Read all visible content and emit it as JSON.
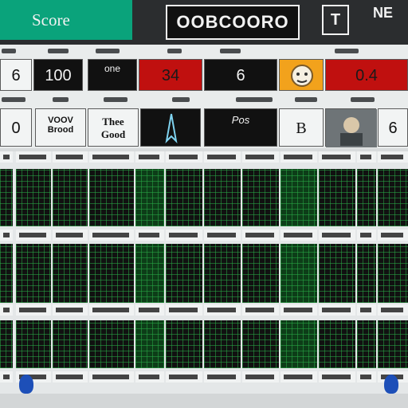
{
  "header": {
    "score_label": "Score",
    "title": "OOBCOORO",
    "tool_icon": "T",
    "corner_label": "NE"
  },
  "row1": [
    {
      "value": "6"
    },
    {
      "value": "100"
    },
    {
      "value": "one"
    },
    {
      "value": "34"
    },
    {
      "value": "6"
    },
    {
      "value": ""
    },
    {
      "value": "0.4"
    }
  ],
  "row2": [
    {
      "value": "0"
    },
    {
      "line1": "VOOV",
      "line2": "Brood"
    },
    {
      "line1": "Thee",
      "line2": "Good"
    },
    {
      "value": ""
    },
    {
      "value": "Pos"
    },
    {
      "value": "B"
    },
    {
      "value": ""
    },
    {
      "value": "6"
    }
  ],
  "icons": {
    "avatar": "lion-avatar-icon",
    "rocket": "rocket-icon",
    "drop_left": "drop-icon",
    "drop_right": "drop-icon"
  },
  "colors": {
    "accent": "#0aa37b",
    "alert": "#c0100f",
    "warning": "#f2a21c",
    "grid_green": "#2aa046"
  }
}
